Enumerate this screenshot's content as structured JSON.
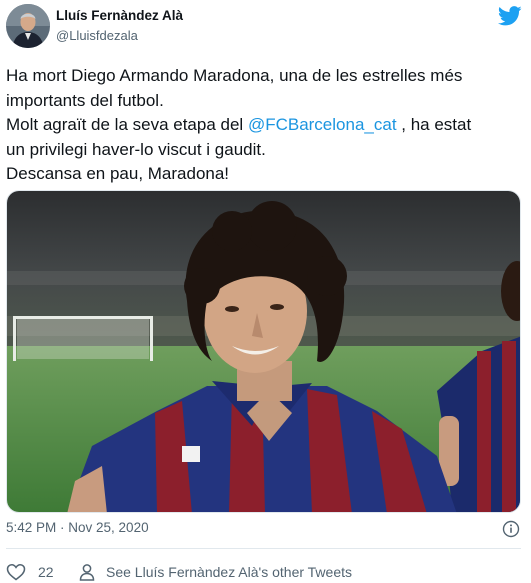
{
  "author": {
    "name": "Lluís Fernàndez Alà",
    "handle": "@Lluisfdezala"
  },
  "tweet": {
    "lines": [
      "Ha mort Diego Armando Maradona, una de les estrelles més",
      "importants del futbol."
    ],
    "line3_before": "Molt agraït de la seva etapa del ",
    "mention": "@FCBarcelona_cat",
    "line3_after": " , ha estat",
    "line4": "un privilegi haver-lo viscut i gaudit.",
    "line5": "Descansa en pau, Maradona!"
  },
  "footer": {
    "timestamp": "5:42 PM · Nov 25, 2020",
    "like_count": "22",
    "other_tweets_label": "See Lluís Fernàndez Alà's other Tweets"
  },
  "colors": {
    "twitter_blue": "#1da1f2",
    "mention": "#1b95e0",
    "muted": "#536471"
  },
  "icons": {
    "brand": "twitter-bird-icon",
    "info": "info-icon",
    "like": "heart-icon",
    "profile": "person-icon"
  }
}
